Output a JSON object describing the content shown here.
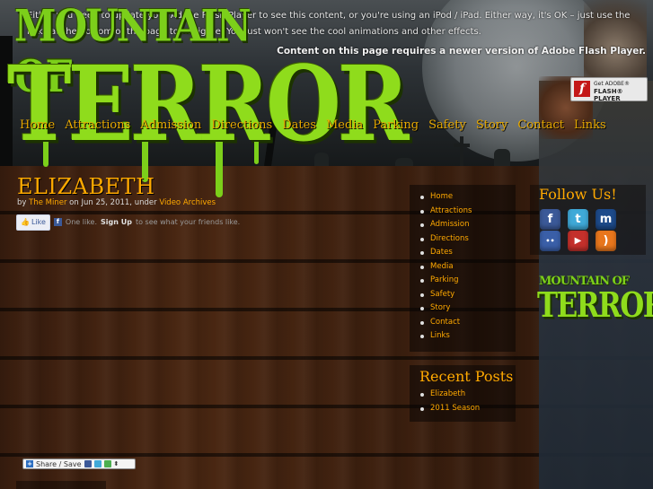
{
  "flash_notice": {
    "message": "Either you need to update your Adobe Flash Player to see this content, or you're using an iPod / iPad. Either way, it's OK – just use the links at the bottom of the page to navigate. You just won't see the cool animations and other effects.",
    "requirement": "Content on this page requires a newer version of Adobe Flash Player.",
    "badge_line1": "Get ADOBE®",
    "badge_line2": "FLASH® PLAYER",
    "badge_glyph": "f"
  },
  "logo": {
    "line1": "MOUNTAIN OF",
    "line2": "TERROR"
  },
  "top_nav": [
    "Home",
    "Attractions",
    "Admission",
    "Directions",
    "Dates",
    "Media",
    "Parking",
    "Safety",
    "Story",
    "Contact",
    "Links"
  ],
  "post": {
    "title": "ELIZABETH",
    "by": "by",
    "author": "The Miner",
    "date_text": "on Jun 25, 2011, under",
    "category": "Video Archives"
  },
  "facebook": {
    "like_label": "Like",
    "count_text": "One like.",
    "signup": "Sign Up",
    "suffix": "to see what your friends like."
  },
  "share": {
    "label": "Share / Save"
  },
  "sidebar_menu": [
    "Home",
    "Attractions",
    "Admission",
    "Directions",
    "Dates",
    "Media",
    "Parking",
    "Safety",
    "Story",
    "Contact",
    "Links"
  ],
  "recent_posts": {
    "heading": "Recent Posts",
    "items": [
      "Elizabeth",
      "2011 Season"
    ]
  },
  "follow": {
    "heading": "Follow Us!",
    "icons": [
      {
        "name": "facebook-icon",
        "glyph": "f",
        "color": "#3b5998"
      },
      {
        "name": "twitter-icon",
        "glyph": "t",
        "color": "#3fa9d8"
      },
      {
        "name": "myspace-icon",
        "glyph": "m",
        "color": "#1d4a8a"
      },
      {
        "name": "flickr-icon",
        "glyph": "••",
        "color": "#3a5fa8"
      },
      {
        "name": "youtube-icon",
        "glyph": "▶",
        "color": "#c4302b"
      },
      {
        "name": "rss-icon",
        "glyph": ")",
        "color": "#e8761c"
      }
    ]
  },
  "colors": {
    "accent": "#ffa900",
    "logo_green": "#8fdc1c",
    "wood": "#4a2712"
  }
}
